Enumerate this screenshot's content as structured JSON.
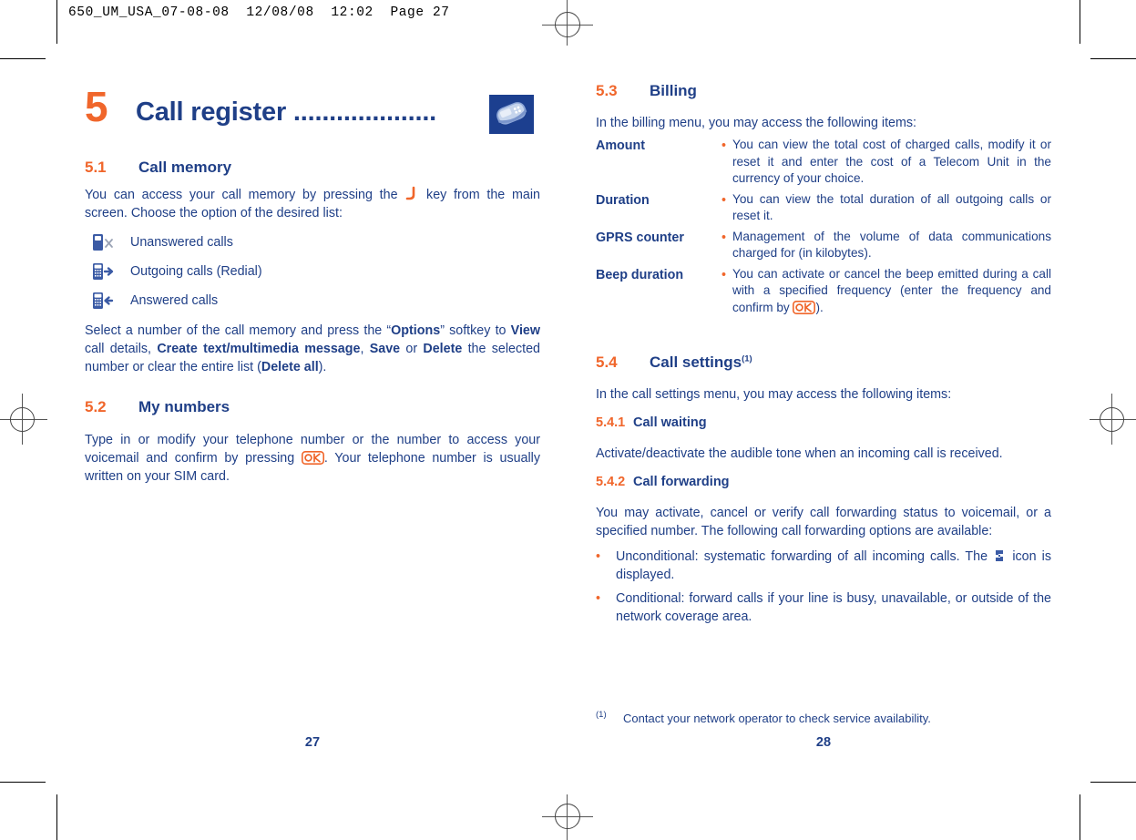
{
  "film_header": "650_UM_USA_07-08-08  12/08/08  12:02  Page 27",
  "colors": {
    "accent_orange": "#f0662b",
    "body_blue": "#1f3f87",
    "icon_blue": "#1c3f8f"
  },
  "left_page": {
    "folio": "27",
    "chapter": {
      "number": "5",
      "title": "Call register ....................",
      "icon": "mobile-phone-icon"
    },
    "section_5_1": {
      "number": "5.1",
      "title": "Call memory",
      "intro_before_icon": "You can access your call memory by pressing the",
      "intro_icon": "call-handset-icon",
      "intro_after_icon": "key from the main screen. Choose the option of the desired list:",
      "items": [
        {
          "icon": "unanswered-call-icon",
          "label": "Unanswered calls"
        },
        {
          "icon": "outgoing-call-icon",
          "label": "Outgoing calls (Redial)"
        },
        {
          "icon": "answered-call-icon",
          "label": "Answered calls"
        }
      ],
      "options_paragraph": {
        "part1": "Select a number of the call memory and press the “",
        "b1": "Options",
        "part2": "” softkey to ",
        "b2": "View",
        "part3": " call details, ",
        "b3": "Create text/multimedia message",
        "part4": ", ",
        "b4": "Save",
        "part5": " or ",
        "b5": "Delete",
        "part6": " the selected number or clear the entire list (",
        "b6": "Delete all",
        "part7": ")."
      }
    },
    "section_5_2": {
      "number": "5.2",
      "title": "My numbers",
      "text_before_icon": "Type in or modify your telephone number or the number to access your voicemail and confirm by pressing",
      "icon": "ok-key-icon",
      "text_after_icon": ". Your telephone number is usually written on your SIM card."
    }
  },
  "right_page": {
    "folio": "28",
    "section_5_3": {
      "number": "5.3",
      "title": "Billing",
      "intro": "In the billing menu, you may access the following items:",
      "bullet_char": "•",
      "items": [
        {
          "term": "Amount",
          "description": "You can view the total cost of charged calls, modify it or reset it and enter the cost of a Telecom Unit in the currency of your choice."
        },
        {
          "term": "Duration",
          "description": "You can view the total duration of all outgoing calls or reset it."
        },
        {
          "term": "GPRS counter",
          "description": "Management of the volume of data communications charged for (in kilobytes)."
        },
        {
          "term": "Beep duration",
          "description_before_icon": "You can activate or cancel the beep emitted during a call with a specified frequency (enter the frequency and confirm by",
          "icon": "ok-key-icon",
          "description_after_icon": ")."
        }
      ]
    },
    "section_5_4": {
      "number": "5.4",
      "title": "Call settings",
      "footnote_marker": "(1)",
      "intro": "In the call settings menu, you may access the following items:",
      "sub_5_4_1": {
        "number": "5.4.1",
        "title": "Call waiting",
        "text": "Activate/deactivate the audible tone when an incoming call is received."
      },
      "sub_5_4_2": {
        "number": "5.4.2",
        "title": "Call forwarding",
        "intro": "You may activate, cancel or verify call forwarding status to voicemail, or a specified number.  The following call forwarding options are available:",
        "bullet_char": "•",
        "bullets": [
          {
            "text_before_icon": "Unconditional: systematic forwarding of all incoming calls. The",
            "icon": "call-forward-icon",
            "text_after_icon": "icon is displayed."
          },
          {
            "text": "Conditional: forward calls if your line is busy, unavailable, or outside of the network coverage area."
          }
        ]
      }
    },
    "footnote": {
      "marker": "(1)",
      "text": "Contact your network operator to check service availability."
    }
  }
}
